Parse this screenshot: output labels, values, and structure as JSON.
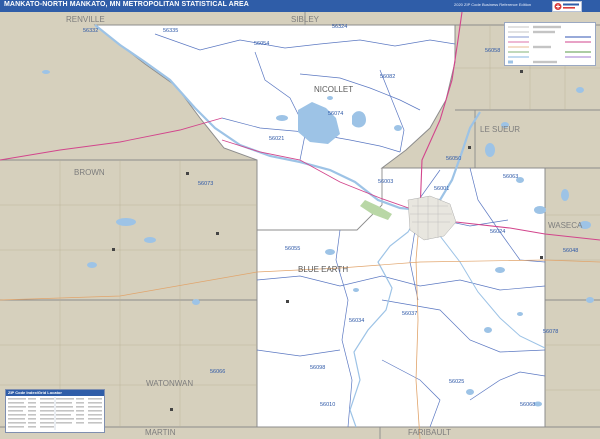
{
  "header": {
    "title": "MANKATO-NORTH MANKATO, MN METROPOLITAN STATISTICAL AREA",
    "edition": "2020 ZIP Code Business Reference Edition"
  },
  "counties": [
    {
      "name": "RENVILLE"
    },
    {
      "name": "SIBLEY"
    },
    {
      "name": "NICOLLET"
    },
    {
      "name": "LE SUEUR"
    },
    {
      "name": "BROWN"
    },
    {
      "name": "BLUE EARTH"
    },
    {
      "name": "WASECA"
    },
    {
      "name": "WATONWAN"
    },
    {
      "name": "MARTIN"
    },
    {
      "name": "FARIBAULT"
    }
  ],
  "zip_labels": [
    "56335",
    "56332",
    "56324",
    "56054",
    "56058",
    "56082",
    "56074",
    "56021",
    "56050",
    "56073",
    "56003",
    "56001",
    "56063",
    "56024",
    "56048",
    "56055",
    "56034",
    "56037",
    "56078",
    "56066",
    "56098",
    "56025",
    "56010",
    "56068"
  ],
  "zip_table": {
    "title": "ZIP Code Index/Grid Locator"
  },
  "colors": {
    "title_bar": "#2f5da8",
    "background_land": "#d6d0bd",
    "msa_area": "#ffffff",
    "water": "#9dc3e6",
    "county_line": "#8c8c8c",
    "zip_line": "#5b78c2",
    "highway": "#d2458c",
    "road": "#e1a46b",
    "zip_label": "#2b56a6",
    "county_label": "#7d7d7d"
  }
}
